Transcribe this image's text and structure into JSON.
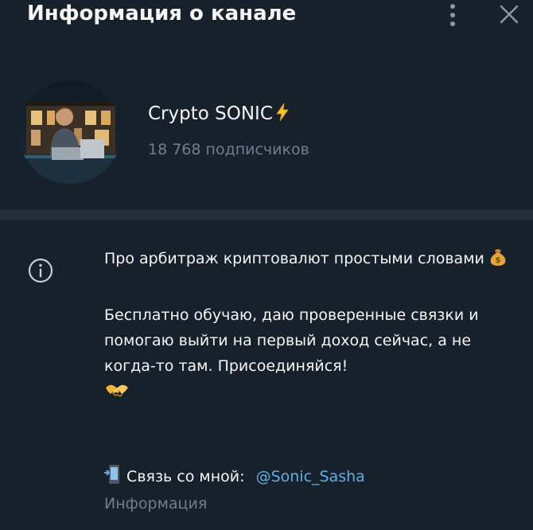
{
  "header": {
    "title": "Информация о канале",
    "menu_icon": "kebab-menu-icon",
    "close_icon": "close-icon"
  },
  "profile": {
    "channel_name": "Crypto SONIC",
    "name_emoji": "lightning-icon",
    "subscribers": "18 768 подписчиков"
  },
  "description": {
    "icon": "info-icon",
    "line1": "Про арбитраж криптовалют простыми словами",
    "line1_emoji": "money-bag-icon",
    "line2": "Бесплатно обучаю, даю проверенные связки и помогаю выйти на первый доход сейчас, а не когда-то там. Присоединяйся!",
    "line2_emoji": "handshake-icon",
    "contact_label": "Связь со мной:",
    "contact_emoji": "phone-icon",
    "contact_link": "@Sonic_Sasha",
    "footer_label": "Информация"
  },
  "colors": {
    "background": "#17212b",
    "divider": "#232e3c",
    "text": "#f5f5f5",
    "muted": "#6d7f8f",
    "link": "#61aee6"
  }
}
